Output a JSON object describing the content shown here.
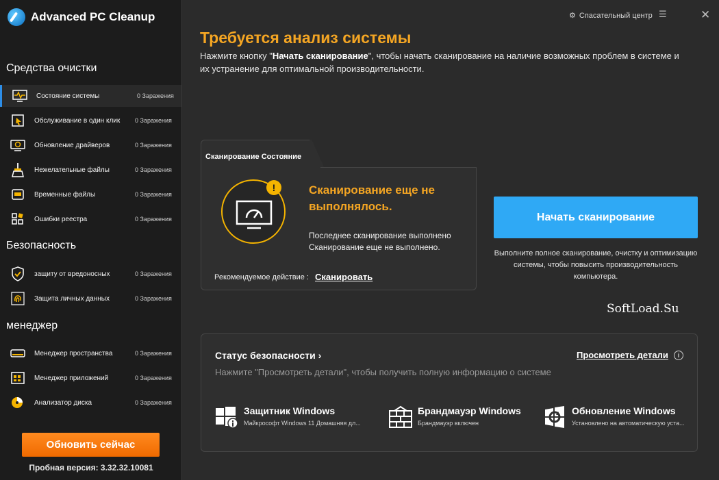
{
  "app": {
    "title": "Advanced PC Cleanup"
  },
  "topbar": {
    "rescue_center": "Спасательный центр"
  },
  "main": {
    "title": "Требуется анализ системы",
    "desc_pre": "Нажмите кнопку \"",
    "desc_bold": "Начать сканирование",
    "desc_post": "\", чтобы начать сканирование на наличие возможных проблем в системе и их устранение для оптимальной производительности."
  },
  "sidebar": {
    "sections": [
      {
        "title": "Средства очистки"
      },
      {
        "title": "Безопасность"
      },
      {
        "title": "менеджер"
      }
    ],
    "items": [
      {
        "label": "Состояние системы",
        "count": "0 Заражения",
        "icon": "monitor-pulse-icon"
      },
      {
        "label": "Обслуживание в один клик",
        "count": "0 Заражения",
        "icon": "one-click-icon"
      },
      {
        "label": "Обновление драйверов",
        "count": "0 Заражения",
        "icon": "driver-update-icon"
      },
      {
        "label": "Нежелательные файлы",
        "count": "0 Заражения",
        "icon": "broom-icon"
      },
      {
        "label": "Временные файлы",
        "count": "0 Заражения",
        "icon": "temp-files-icon"
      },
      {
        "label": "Ошибки реестра",
        "count": "0 Заражения",
        "icon": "registry-icon"
      },
      {
        "label": "защиту от вредоносных",
        "count": "0 Заражения",
        "icon": "shield-check-icon"
      },
      {
        "label": "Защита личных данных",
        "count": "0 Заражения",
        "icon": "fingerprint-icon"
      },
      {
        "label": "Менеджер пространства",
        "count": "0 Заражения",
        "icon": "disk-space-icon"
      },
      {
        "label": "Менеджер приложений",
        "count": "0 Заражения",
        "icon": "app-manager-icon"
      },
      {
        "label": "Анализатор диска",
        "count": "0 Заражения",
        "icon": "disk-analyzer-icon"
      }
    ],
    "upgrade_button": "Обновить сейчас",
    "version": "Пробная версия: 3.32.32.10081"
  },
  "scan": {
    "tab_label": "Сканирование Состояние",
    "status": "Сканирование еще не выполнялось.",
    "last_scan_label": "Последнее сканирование выполнено",
    "last_scan_value": "Сканирование еще не выполнено.",
    "recommend_label": "Рекомендуемое действие :",
    "recommend_action": "Сканировать",
    "start_button": "Начать сканирование",
    "start_desc": "Выполните полное сканирование, очистку и оптимизацию системы, чтобы повысить производительность компьютера."
  },
  "watermark": "SoftLoad.Su",
  "security": {
    "title": "Статус безопасности",
    "details_link": "Просмотреть детали",
    "hint": "Нажмите \"Просмотреть детали\", чтобы получить полную информацию о системе",
    "items": [
      {
        "name": "Защитник Windows",
        "sub": "Майкрософт Windows 11 Домашняя дл...",
        "icon": "windows-defender-icon"
      },
      {
        "name": "Брандмауэр Windows",
        "sub": "Брандмауэр включен",
        "icon": "firewall-icon"
      },
      {
        "name": "Обновление Windows",
        "sub": "Установлено на автоматическую уста...",
        "icon": "windows-update-icon"
      }
    ]
  },
  "colors": {
    "accent_orange": "#f5a623",
    "accent_blue": "#2fa9f5",
    "upgrade_orange": "#f06a00"
  }
}
